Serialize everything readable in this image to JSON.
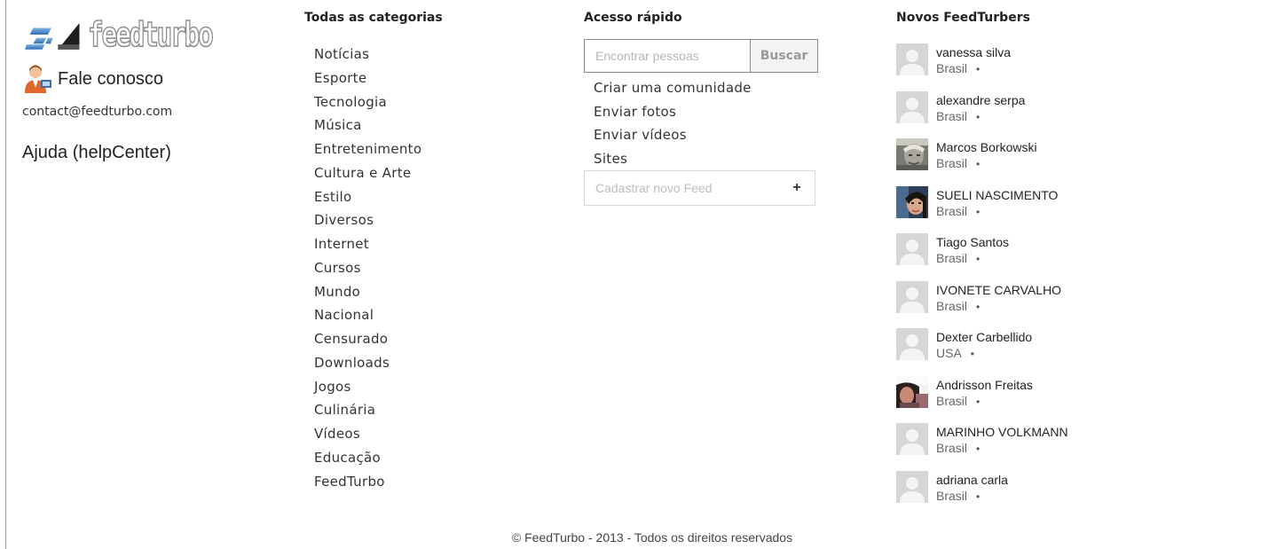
{
  "brand": {
    "logo_text": "feedturbo"
  },
  "contact": {
    "label": "Fale conosco",
    "email": "contact@feedturbo.com",
    "help": "Ajuda (helpCenter)"
  },
  "categories": {
    "heading": "Todas as categorias",
    "items": [
      "Notícias",
      "Esporte",
      "Tecnologia",
      "Música",
      "Entretenimento",
      "Cultura e Arte",
      "Estilo",
      "Diversos",
      "Internet",
      "Cursos",
      "Mundo",
      "Nacional",
      "Censurado",
      "Downloads",
      "Jogos",
      "Culinária",
      "Vídeos",
      "Educação",
      "FeedTurbo"
    ]
  },
  "quick_access": {
    "heading": "Acesso rápido",
    "search_placeholder": "Encontrar pessoas",
    "search_button": "Buscar",
    "links": [
      "Criar uma comunidade",
      "Enviar fotos",
      "Enviar vídeos",
      "Sites"
    ],
    "feed_placeholder": "Cadastrar novo Feed",
    "feed_add": "+"
  },
  "members": {
    "heading": "Novos FeedTurbers",
    "bullet": "•",
    "items": [
      {
        "name": "vanessa silva",
        "country": "Brasil",
        "avatar": "default"
      },
      {
        "name": "alexandre serpa",
        "country": "Brasil",
        "avatar": "default"
      },
      {
        "name": "Marcos Borkowski",
        "country": "Brasil",
        "avatar": "photo"
      },
      {
        "name": "SUELI NASCIMENTO",
        "country": "Brasil",
        "avatar": "photo"
      },
      {
        "name": "Tiago Santos",
        "country": "Brasil",
        "avatar": "default"
      },
      {
        "name": "IVONETE CARVALHO",
        "country": "Brasil",
        "avatar": "default"
      },
      {
        "name": "Dexter Carbellido",
        "country": "USA",
        "avatar": "default"
      },
      {
        "name": "Andrisson Freitas",
        "country": "Brasil",
        "avatar": "photo"
      },
      {
        "name": "MARINHO VOLKMANN",
        "country": "Brasil",
        "avatar": "default"
      },
      {
        "name": "adriana carla",
        "country": "Brasil",
        "avatar": "default"
      }
    ]
  },
  "footer": {
    "text": "© FeedTurbo - 2013 - Todos os direitos reservados"
  }
}
